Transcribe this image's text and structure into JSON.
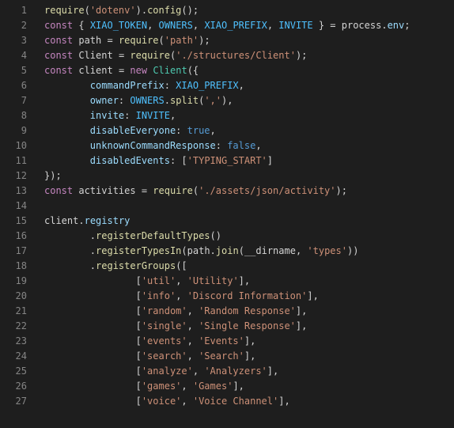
{
  "lines": [
    {
      "n": "1",
      "tokens": [
        [
          "fn",
          "require"
        ],
        [
          "punct",
          "("
        ],
        [
          "str",
          "'dotenv'"
        ],
        [
          "punct",
          ")."
        ],
        [
          "fn",
          "config"
        ],
        [
          "punct",
          "();"
        ]
      ]
    },
    {
      "n": "2",
      "tokens": [
        [
          "kw",
          "const"
        ],
        [
          "punct",
          " { "
        ],
        [
          "constname",
          "XIAO_TOKEN"
        ],
        [
          "punct",
          ", "
        ],
        [
          "constname",
          "OWNERS"
        ],
        [
          "punct",
          ", "
        ],
        [
          "constname",
          "XIAO_PREFIX"
        ],
        [
          "punct",
          ", "
        ],
        [
          "constname",
          "INVITE"
        ],
        [
          "punct",
          " } = "
        ],
        [
          "ident",
          "process"
        ],
        [
          "punct",
          "."
        ],
        [
          "prop",
          "env"
        ],
        [
          "punct",
          ";"
        ]
      ]
    },
    {
      "n": "3",
      "tokens": [
        [
          "kw",
          "const"
        ],
        [
          "punct",
          " "
        ],
        [
          "ident",
          "path"
        ],
        [
          "punct",
          " = "
        ],
        [
          "fn",
          "require"
        ],
        [
          "punct",
          "("
        ],
        [
          "str",
          "'path'"
        ],
        [
          "punct",
          ");"
        ]
      ]
    },
    {
      "n": "4",
      "tokens": [
        [
          "kw",
          "const"
        ],
        [
          "punct",
          " "
        ],
        [
          "ident",
          "Client"
        ],
        [
          "punct",
          " = "
        ],
        [
          "fn",
          "require"
        ],
        [
          "punct",
          "("
        ],
        [
          "str",
          "'./structures/Client'"
        ],
        [
          "punct",
          ");"
        ]
      ]
    },
    {
      "n": "5",
      "tokens": [
        [
          "kw",
          "const"
        ],
        [
          "punct",
          " "
        ],
        [
          "ident",
          "client"
        ],
        [
          "punct",
          " = "
        ],
        [
          "kw",
          "new"
        ],
        [
          "punct",
          " "
        ],
        [
          "class",
          "Client"
        ],
        [
          "punct",
          "({"
        ]
      ]
    },
    {
      "n": "6",
      "indent": 2,
      "tokens": [
        [
          "prop",
          "commandPrefix"
        ],
        [
          "punct",
          ": "
        ],
        [
          "constname",
          "XIAO_PREFIX"
        ],
        [
          "punct",
          ","
        ]
      ]
    },
    {
      "n": "7",
      "indent": 2,
      "tokens": [
        [
          "prop",
          "owner"
        ],
        [
          "punct",
          ": "
        ],
        [
          "constname",
          "OWNERS"
        ],
        [
          "punct",
          "."
        ],
        [
          "fn",
          "split"
        ],
        [
          "punct",
          "("
        ],
        [
          "str",
          "','"
        ],
        [
          "punct",
          "),"
        ]
      ]
    },
    {
      "n": "8",
      "indent": 2,
      "tokens": [
        [
          "prop",
          "invite"
        ],
        [
          "punct",
          ": "
        ],
        [
          "constname",
          "INVITE"
        ],
        [
          "punct",
          ","
        ]
      ]
    },
    {
      "n": "9",
      "indent": 2,
      "tokens": [
        [
          "prop",
          "disableEveryone"
        ],
        [
          "punct",
          ": "
        ],
        [
          "bool",
          "true"
        ],
        [
          "punct",
          ","
        ]
      ]
    },
    {
      "n": "10",
      "indent": 2,
      "tokens": [
        [
          "prop",
          "unknownCommandResponse"
        ],
        [
          "punct",
          ": "
        ],
        [
          "bool",
          "false"
        ],
        [
          "punct",
          ","
        ]
      ]
    },
    {
      "n": "11",
      "indent": 2,
      "tokens": [
        [
          "prop",
          "disabledEvents"
        ],
        [
          "punct",
          ": ["
        ],
        [
          "str",
          "'TYPING_START'"
        ],
        [
          "punct",
          "]"
        ]
      ]
    },
    {
      "n": "12",
      "tokens": [
        [
          "punct",
          "});"
        ]
      ]
    },
    {
      "n": "13",
      "tokens": [
        [
          "kw",
          "const"
        ],
        [
          "punct",
          " "
        ],
        [
          "ident",
          "activities"
        ],
        [
          "punct",
          " = "
        ],
        [
          "fn",
          "require"
        ],
        [
          "punct",
          "("
        ],
        [
          "str",
          "'./assets/json/activity'"
        ],
        [
          "punct",
          ");"
        ]
      ]
    },
    {
      "n": "14",
      "tokens": []
    },
    {
      "n": "15",
      "tokens": [
        [
          "ident",
          "client"
        ],
        [
          "punct",
          "."
        ],
        [
          "prop",
          "registry"
        ]
      ]
    },
    {
      "n": "16",
      "indent": 2,
      "tokens": [
        [
          "punct",
          "."
        ],
        [
          "fn",
          "registerDefaultTypes"
        ],
        [
          "punct",
          "()"
        ]
      ]
    },
    {
      "n": "17",
      "indent": 2,
      "tokens": [
        [
          "punct",
          "."
        ],
        [
          "fn",
          "registerTypesIn"
        ],
        [
          "punct",
          "("
        ],
        [
          "ident",
          "path"
        ],
        [
          "punct",
          "."
        ],
        [
          "fn",
          "join"
        ],
        [
          "punct",
          "("
        ],
        [
          "ident",
          "__dirname"
        ],
        [
          "punct",
          ", "
        ],
        [
          "str",
          "'types'"
        ],
        [
          "punct",
          "))"
        ]
      ]
    },
    {
      "n": "18",
      "indent": 2,
      "tokens": [
        [
          "punct",
          "."
        ],
        [
          "fn",
          "registerGroups"
        ],
        [
          "punct",
          "(["
        ]
      ]
    },
    {
      "n": "19",
      "indent": 4,
      "tokens": [
        [
          "punct",
          "["
        ],
        [
          "str",
          "'util'"
        ],
        [
          "punct",
          ", "
        ],
        [
          "str",
          "'Utility'"
        ],
        [
          "punct",
          "],"
        ]
      ]
    },
    {
      "n": "20",
      "indent": 4,
      "tokens": [
        [
          "punct",
          "["
        ],
        [
          "str",
          "'info'"
        ],
        [
          "punct",
          ", "
        ],
        [
          "str",
          "'Discord Information'"
        ],
        [
          "punct",
          "],"
        ]
      ]
    },
    {
      "n": "21",
      "indent": 4,
      "tokens": [
        [
          "punct",
          "["
        ],
        [
          "str",
          "'random'"
        ],
        [
          "punct",
          ", "
        ],
        [
          "str",
          "'Random Response'"
        ],
        [
          "punct",
          "],"
        ]
      ]
    },
    {
      "n": "22",
      "indent": 4,
      "tokens": [
        [
          "punct",
          "["
        ],
        [
          "str",
          "'single'"
        ],
        [
          "punct",
          ", "
        ],
        [
          "str",
          "'Single Response'"
        ],
        [
          "punct",
          "],"
        ]
      ]
    },
    {
      "n": "23",
      "indent": 4,
      "tokens": [
        [
          "punct",
          "["
        ],
        [
          "str",
          "'events'"
        ],
        [
          "punct",
          ", "
        ],
        [
          "str",
          "'Events'"
        ],
        [
          "punct",
          "],"
        ]
      ]
    },
    {
      "n": "24",
      "indent": 4,
      "tokens": [
        [
          "punct",
          "["
        ],
        [
          "str",
          "'search'"
        ],
        [
          "punct",
          ", "
        ],
        [
          "str",
          "'Search'"
        ],
        [
          "punct",
          "],"
        ]
      ]
    },
    {
      "n": "25",
      "indent": 4,
      "tokens": [
        [
          "punct",
          "["
        ],
        [
          "str",
          "'analyze'"
        ],
        [
          "punct",
          ", "
        ],
        [
          "str",
          "'Analyzers'"
        ],
        [
          "punct",
          "],"
        ]
      ]
    },
    {
      "n": "26",
      "indent": 4,
      "tokens": [
        [
          "punct",
          "["
        ],
        [
          "str",
          "'games'"
        ],
        [
          "punct",
          ", "
        ],
        [
          "str",
          "'Games'"
        ],
        [
          "punct",
          "],"
        ]
      ]
    },
    {
      "n": "27",
      "indent": 4,
      "tokens": [
        [
          "punct",
          "["
        ],
        [
          "str",
          "'voice'"
        ],
        [
          "punct",
          ", "
        ],
        [
          "str",
          "'Voice Channel'"
        ],
        [
          "punct",
          "],"
        ]
      ]
    }
  ],
  "indents": {
    "2": "        ",
    "4": "                "
  }
}
